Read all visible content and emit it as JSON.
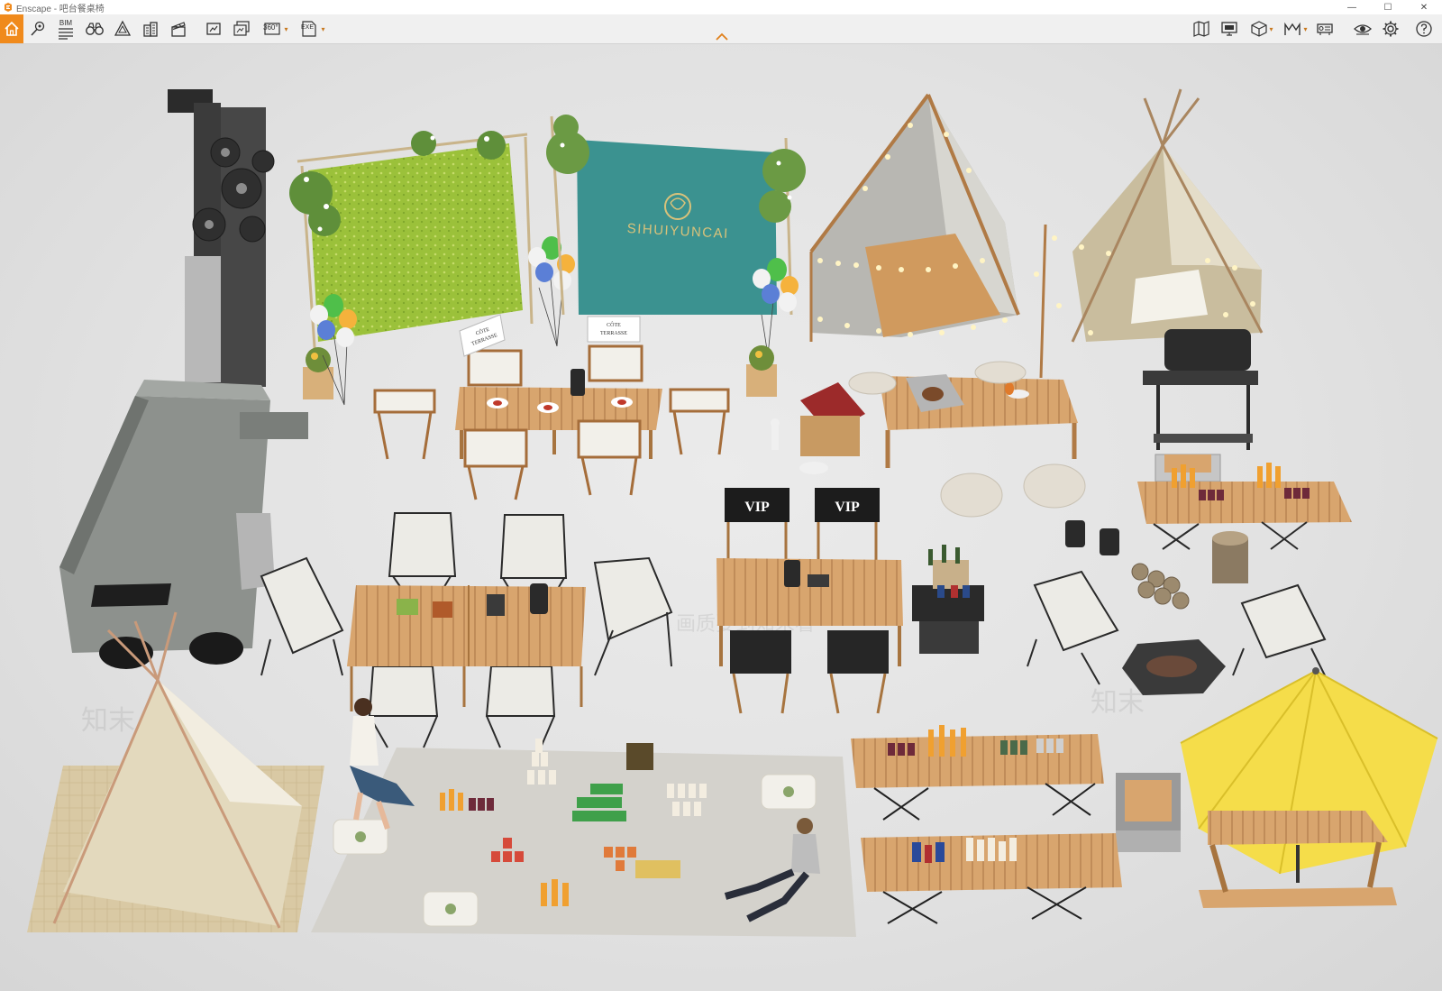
{
  "window": {
    "title": "Enscape - 吧台餐桌椅",
    "controls": {
      "minimize": "—",
      "maximize": "☐",
      "close": "✕"
    }
  },
  "toolbar": {
    "accent_color": "#f08a1c",
    "left_tools": [
      {
        "icon": "home-icon"
      },
      {
        "icon": "location-pin-icon"
      },
      {
        "icon": "bim-list-icon",
        "label": "BIM"
      },
      {
        "icon": "binoculars-icon"
      },
      {
        "icon": "sketch-asset-icon"
      },
      {
        "icon": "building-library-icon"
      },
      {
        "icon": "clapperboard-icon"
      },
      {
        "icon": "screenshot-icon"
      },
      {
        "icon": "batch-render-icon"
      },
      {
        "icon": "panorama-icon",
        "label": "360°"
      },
      {
        "icon": "export-exe-icon",
        "label": "EXE"
      }
    ],
    "right_tools": [
      {
        "icon": "map-view-icon"
      },
      {
        "icon": "monitor-icon"
      },
      {
        "icon": "cube-icon"
      },
      {
        "icon": "vr-headset-icon"
      },
      {
        "icon": "projector-icon"
      },
      {
        "icon": "eye-visibility-icon"
      },
      {
        "icon": "settings-gear-icon"
      },
      {
        "icon": "help-icon"
      }
    ]
  },
  "scene": {
    "banner_text": "SIHUIYUNCAI",
    "sign_text_line1": "CÔTE",
    "sign_text_line2": "TERRASSE",
    "vip_label": "VIP",
    "watermark_texts": [
      "知末",
      "画质要到知末看"
    ],
    "umbrella_color": "#f5dd4a",
    "moss_wall_color": "#9bc13a",
    "banner_color": "#2f8c8a"
  }
}
